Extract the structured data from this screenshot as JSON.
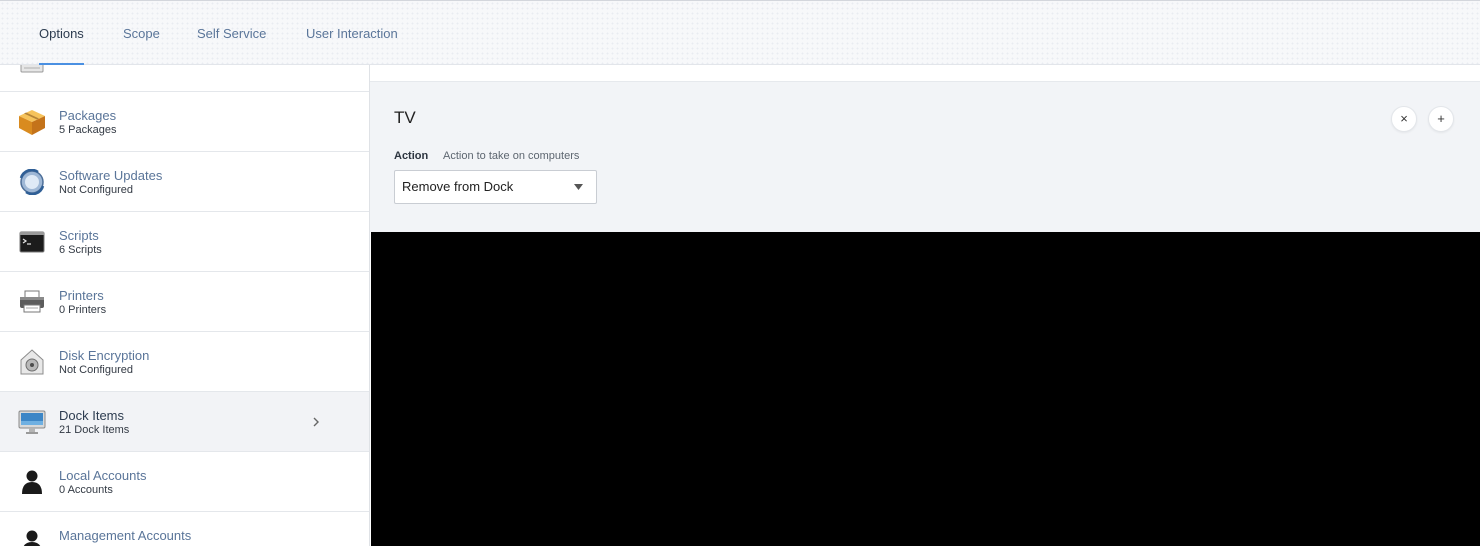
{
  "tabs": [
    {
      "label": "Options",
      "active": true
    },
    {
      "label": "Scope",
      "active": false
    },
    {
      "label": "Self Service",
      "active": false
    },
    {
      "label": "User Interaction",
      "active": false
    }
  ],
  "sidebar": {
    "items": [
      {
        "title": "Packages",
        "subtitle": "5 Packages",
        "icon": "package-icon"
      },
      {
        "title": "Software Updates",
        "subtitle": "Not Configured",
        "icon": "software-update-icon"
      },
      {
        "title": "Scripts",
        "subtitle": "6 Scripts",
        "icon": "terminal-icon"
      },
      {
        "title": "Printers",
        "subtitle": "0 Printers",
        "icon": "printer-icon"
      },
      {
        "title": "Disk Encryption",
        "subtitle": "Not Configured",
        "icon": "disk-encryption-icon"
      },
      {
        "title": "Dock Items",
        "subtitle": "21 Dock Items",
        "icon": "monitor-icon",
        "selected": true
      },
      {
        "title": "Local Accounts",
        "subtitle": "0 Accounts",
        "icon": "user-icon"
      },
      {
        "title": "Management Accounts",
        "subtitle": "",
        "icon": "admin-user-icon"
      }
    ]
  },
  "dock_item": {
    "title": "TV",
    "remove_label": "×",
    "add_label": "+",
    "action_label": "Action",
    "action_hint": "Action to take on computers",
    "action_value": "Remove from Dock"
  },
  "colors": {
    "accent": "#4a90e2",
    "link": "#5a7599",
    "panel_bg": "#f2f4f7"
  }
}
